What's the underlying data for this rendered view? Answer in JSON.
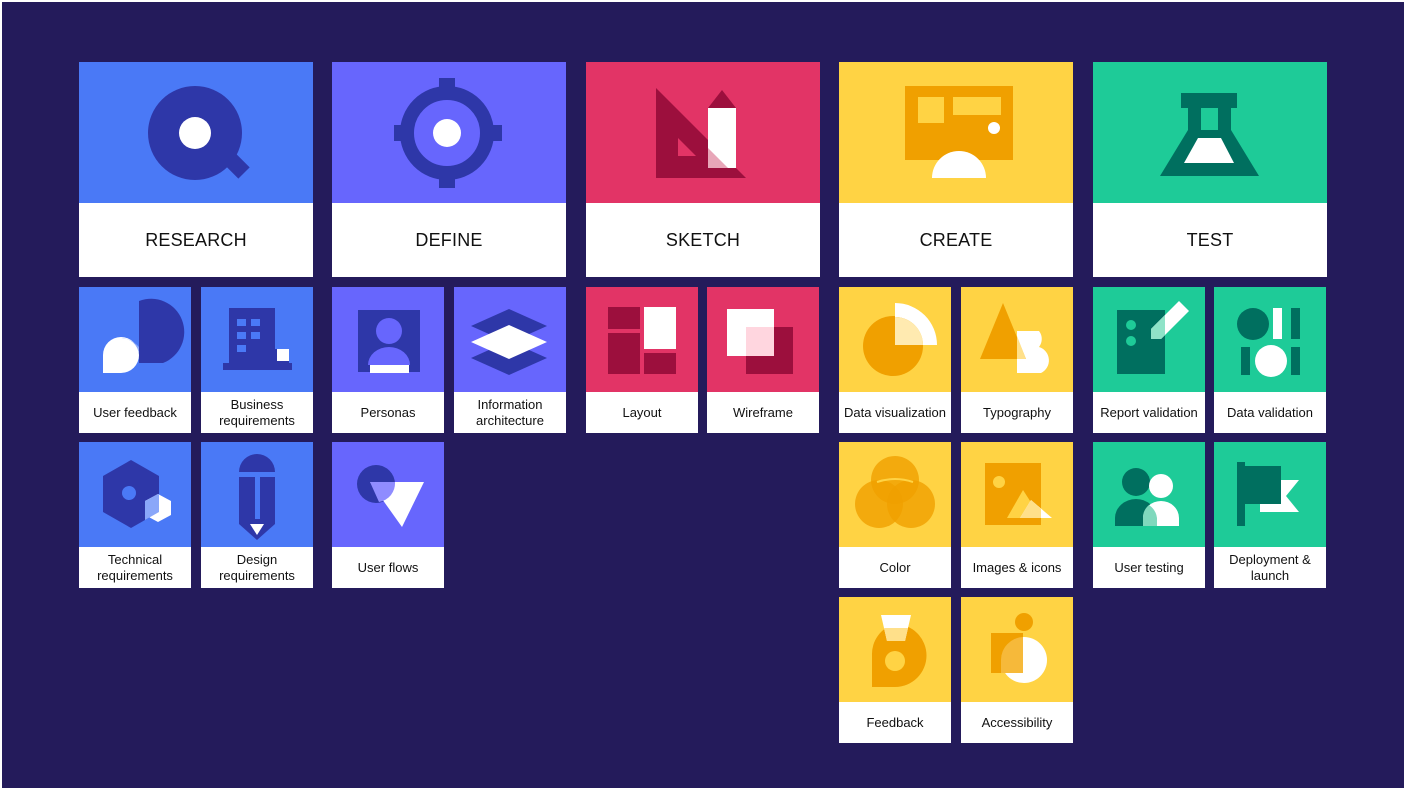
{
  "colors": {
    "background": "#241b5b",
    "research": "#4a79f6",
    "define": "#6766fd",
    "sketch": "#e23466",
    "create": "#ffd344",
    "test": "#1ecb98"
  },
  "stages": [
    {
      "label": "RESEARCH",
      "icon": "magnifier-icon"
    },
    {
      "label": "DEFINE",
      "icon": "target-icon"
    },
    {
      "label": "SKETCH",
      "icon": "ruler-pencil-icon"
    },
    {
      "label": "CREATE",
      "icon": "presentation-board-icon"
    },
    {
      "label": "TEST",
      "icon": "flask-icon"
    }
  ],
  "research": [
    {
      "label": "User feedback",
      "icon": "chat-bubbles-icon"
    },
    {
      "label": "Business requirements",
      "icon": "building-icon"
    },
    {
      "label": "Technical requirements",
      "icon": "hexagon-icon"
    },
    {
      "label": "Design requirements",
      "icon": "pencil-icon"
    }
  ],
  "define": [
    {
      "label": "Personas",
      "icon": "person-card-icon"
    },
    {
      "label": "Information architecture",
      "icon": "layers-icon"
    },
    {
      "label": "User flows",
      "icon": "flow-shapes-icon"
    }
  ],
  "sketch": [
    {
      "label": "Layout",
      "icon": "layout-grid-icon"
    },
    {
      "label": "Wireframe",
      "icon": "overlapping-squares-icon"
    }
  ],
  "create": [
    {
      "label": "Data visualization",
      "icon": "pie-chart-icon"
    },
    {
      "label": "Typography",
      "icon": "letter-shapes-icon"
    },
    {
      "label": "Color",
      "icon": "color-circles-icon"
    },
    {
      "label": "Images & icons",
      "icon": "image-icon"
    },
    {
      "label": "Feedback",
      "icon": "feedback-shape-icon"
    },
    {
      "label": "Accessibility",
      "icon": "accessibility-icon"
    }
  ],
  "test": [
    {
      "label": "Report validation",
      "icon": "report-check-icon"
    },
    {
      "label": "Data validation",
      "icon": "data-shapes-icon"
    },
    {
      "label": "User testing",
      "icon": "users-icon"
    },
    {
      "label": "Deployment & launch",
      "icon": "flag-icon"
    }
  ]
}
